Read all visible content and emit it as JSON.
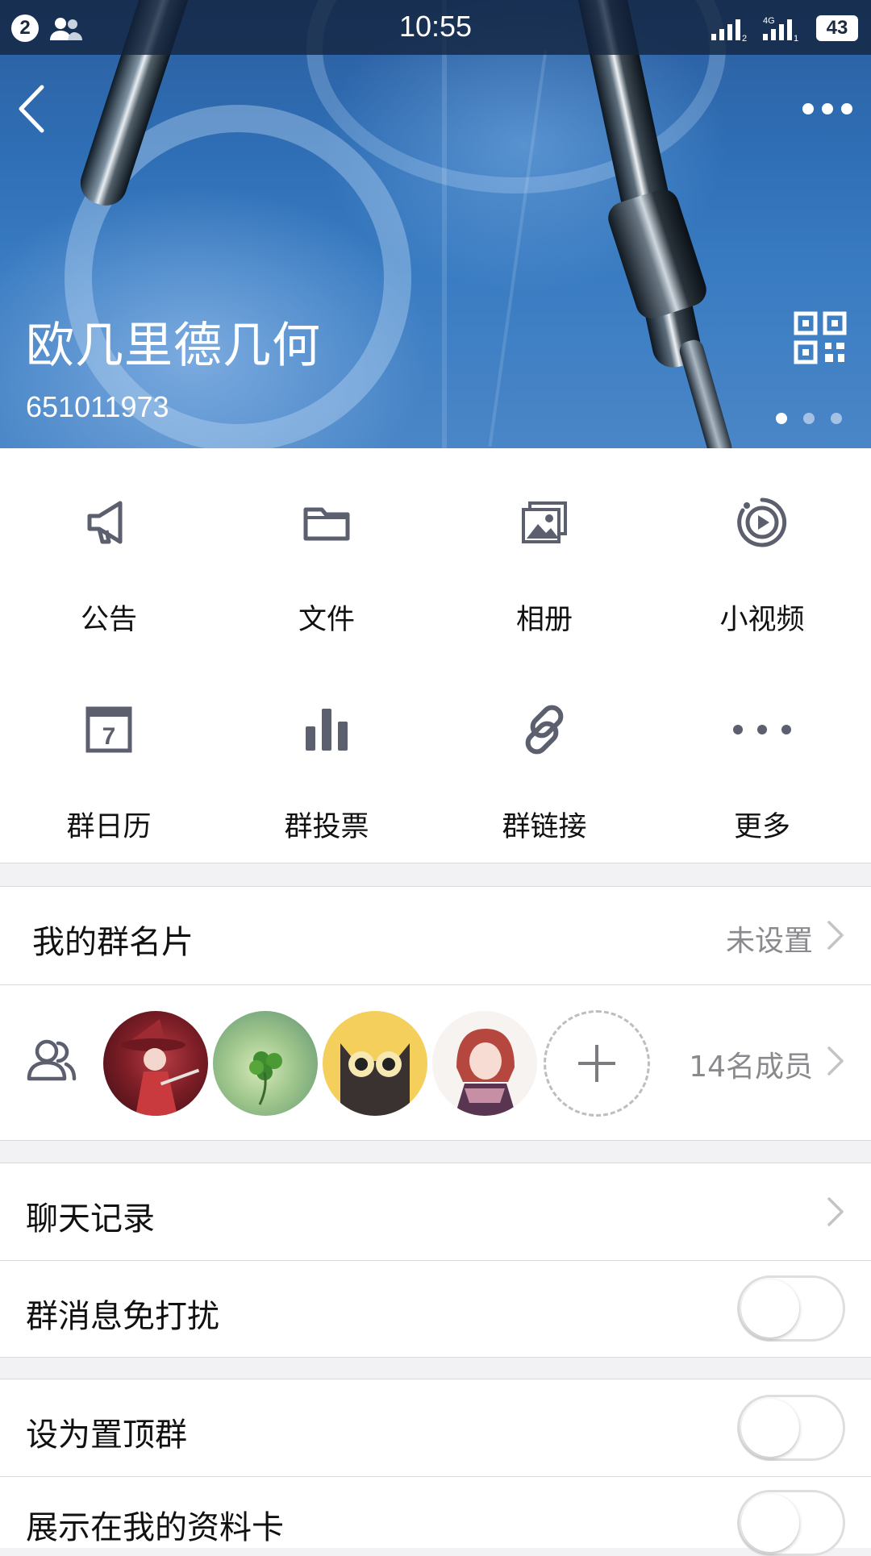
{
  "status_bar": {
    "notification_count": "2",
    "time": "10:55",
    "network": "4G",
    "battery": "43"
  },
  "header": {
    "group_name": "欧几里德几何",
    "group_id": "651011973",
    "page_indicator": {
      "count": 3,
      "active": 0
    }
  },
  "features": [
    {
      "label": "公告",
      "icon": "megaphone-icon"
    },
    {
      "label": "文件",
      "icon": "folder-icon"
    },
    {
      "label": "相册",
      "icon": "photo-album-icon"
    },
    {
      "label": "小视频",
      "icon": "video-play-icon"
    },
    {
      "label": "群日历",
      "icon": "calendar-icon",
      "icon_text": "7"
    },
    {
      "label": "群投票",
      "icon": "bar-chart-icon"
    },
    {
      "label": "群链接",
      "icon": "link-icon"
    },
    {
      "label": "更多",
      "icon": "more-dots-icon"
    }
  ],
  "my_card": {
    "label": "我的群名片",
    "value": "未设置"
  },
  "members": {
    "count_text": "14名成员",
    "icon": "members-icon",
    "avatars": [
      "avatar-witch",
      "avatar-clover",
      "avatar-cat",
      "avatar-anime-girl"
    ]
  },
  "chat_history": {
    "label": "聊天记录"
  },
  "settings": [
    {
      "label": "群消息免打扰",
      "on": false
    },
    {
      "label": "设为置顶群",
      "on": false
    },
    {
      "label": "展示在我的资料卡",
      "on": false
    }
  ],
  "colors": {
    "icon": "#5b5f6e",
    "accent_blue": "#2f6fb6",
    "chevron": "#c4c4c8"
  }
}
